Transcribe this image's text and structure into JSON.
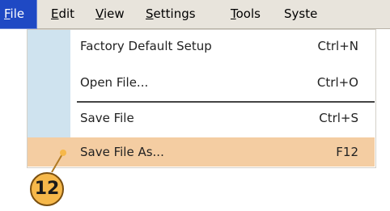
{
  "menubar": {
    "items": [
      {
        "label": "File",
        "accel": "F",
        "rest": "ile"
      },
      {
        "label": "Edit",
        "accel": "E",
        "rest": "dit"
      },
      {
        "label": "View",
        "accel": "V",
        "rest": "iew"
      },
      {
        "label": "Settings",
        "accel": "S",
        "rest": "ettings"
      },
      {
        "label": "Tools",
        "accel": "T",
        "rest": "ools"
      },
      {
        "label": "Syste",
        "accel": "",
        "rest": "Syste"
      }
    ]
  },
  "file_menu": {
    "items": [
      {
        "label": "Factory Default Setup",
        "shortcut": "Ctrl+N"
      },
      {
        "label": "Open File...",
        "shortcut": "Ctrl+O"
      },
      {
        "label": "Save File",
        "shortcut": "Ctrl+S"
      },
      {
        "label": "Save File As...",
        "shortcut": "F12"
      }
    ],
    "highlighted_index": 3
  },
  "callout": {
    "number": "12"
  },
  "colors": {
    "menubar_bg": "#e8e4dc",
    "active_menu_bg": "#1f49c4",
    "icon_strip": "#cfe3ef",
    "highlight": "#f4cda2",
    "badge": "#f6b84a"
  }
}
